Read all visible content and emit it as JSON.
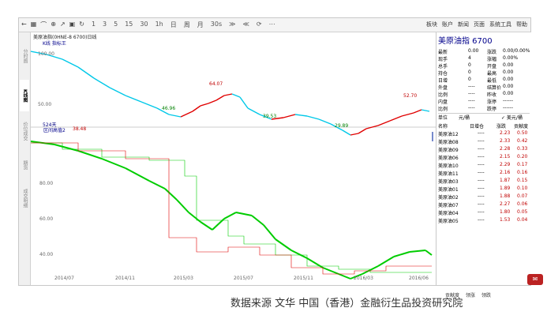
{
  "toolbar": {
    "icons": [
      "back-icon",
      "grid-icon",
      "line-icon",
      "crosshair-icon",
      "arrow-icon",
      "save-icon",
      "refresh-icon"
    ],
    "periods": [
      "1",
      "3",
      "5",
      "15",
      "30",
      "1h",
      "日",
      "周",
      "月",
      "30s",
      "≫",
      "≪",
      "⟳",
      "⋯"
    ],
    "right_items": [
      "板块",
      "账户",
      "新闻",
      "页面",
      "系统工具",
      "帮助"
    ]
  },
  "left_tabs": [
    {
      "label": "分时图",
      "active": false
    },
    {
      "label": "K线图",
      "active": true
    },
    {
      "label": "价位成交",
      "active": false
    },
    {
      "label": "期货",
      "active": false
    },
    {
      "label": "成交明细",
      "active": false
    }
  ],
  "chart": {
    "title": "美原油指(0HNE-8 6700)日线",
    "sub_title": "K线 指标王",
    "label_524": "524天",
    "sub2_title": "区间高值2",
    "sub2_value": "38.48",
    "y_labels_top": [
      "100.00",
      "50.00"
    ],
    "y_labels_bottom": [
      "80.00",
      "60.00",
      "40.00"
    ],
    "x_labels": [
      "2014/07",
      "2014/11",
      "2015/03",
      "2015/07",
      "2015/11",
      "2016/03",
      "2016/06"
    ],
    "annotations_top": [
      {
        "text": "64.07",
        "color": "#c00000"
      },
      {
        "text": "46.96",
        "color": "#008000"
      },
      {
        "text": "39.53",
        "color": "#008000"
      },
      {
        "text": "29.89",
        "color": "#008000"
      },
      {
        "text": "52.70",
        "color": "#c00000"
      }
    ]
  },
  "quote": {
    "title": "美原油指  6700",
    "rows": [
      {
        "l1": "最新",
        "v1": "0.00",
        "l2": "涨跌",
        "v2": "0.00/0.00%"
      },
      {
        "l1": "现手",
        "v1": "4",
        "l2": "涨幅",
        "v2": "0.00%"
      },
      {
        "l1": "总手",
        "v1": "0",
        "l2": "开盘",
        "v2": "0.00"
      },
      {
        "l1": "持仓",
        "v1": "0",
        "l2": "最高",
        "v2": "0.00"
      },
      {
        "l1": "日增",
        "v1": "0",
        "l2": "最低",
        "v2": "0.00"
      },
      {
        "l1": "外盘",
        "v1": "----",
        "l2": "结算价",
        "v2": "0.00"
      },
      {
        "l1": "比例",
        "v1": "----",
        "l2": "昨收",
        "v2": "0.00"
      },
      {
        "l1": "内盘",
        "v1": "----",
        "l2": "涨停",
        "v2": "------"
      },
      {
        "l1": "比例",
        "v1": "----",
        "l2": "跌停",
        "v2": "------"
      }
    ],
    "unit_label": "单位",
    "unit_value": "元/桶",
    "unit_check": "✓ 美元/桶",
    "table_headers": [
      "名称",
      "日增仓",
      "涨跌",
      "贡献度"
    ],
    "table_rows": [
      {
        "name": "美原油12",
        "chg": "----",
        "val": "2.23",
        "contrib": "0.50"
      },
      {
        "name": "美原油08",
        "chg": "----",
        "val": "2.33",
        "contrib": "0.42"
      },
      {
        "name": "美原油09",
        "chg": "----",
        "val": "2.28",
        "contrib": "0.33"
      },
      {
        "name": "美原油06",
        "chg": "----",
        "val": "2.15",
        "contrib": "0.20"
      },
      {
        "name": "美原油10",
        "chg": "----",
        "val": "2.29",
        "contrib": "0.17"
      },
      {
        "name": "美原油11",
        "chg": "----",
        "val": "2.16",
        "contrib": "0.16"
      },
      {
        "name": "美原油03",
        "chg": "----",
        "val": "1.87",
        "contrib": "0.15"
      },
      {
        "name": "美原油01",
        "chg": "----",
        "val": "1.89",
        "contrib": "0.10"
      },
      {
        "name": "美原油02",
        "chg": "----",
        "val": "1.88",
        "contrib": "0.07"
      },
      {
        "name": "美原油07",
        "chg": "----",
        "val": "2.27",
        "contrib": "0.06"
      },
      {
        "name": "美原油04",
        "chg": "----",
        "val": "1.80",
        "contrib": "0.05"
      },
      {
        "name": "美原油05",
        "chg": "----",
        "val": "1.53",
        "contrib": "0.04"
      }
    ],
    "bottom_tabs": [
      "贡献度",
      "领涨",
      "领跌"
    ]
  },
  "caption": "数据来源  文华  中国（香港）金融衍生品投资研究院"
}
